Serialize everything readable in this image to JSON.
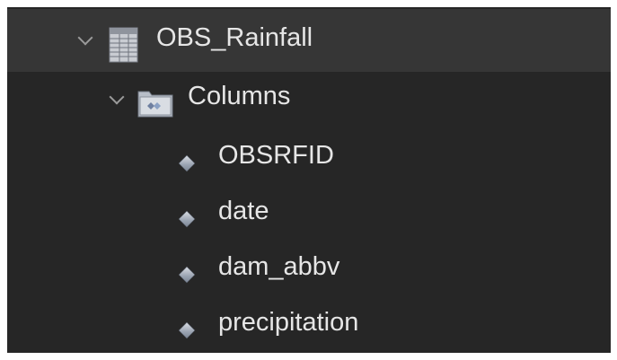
{
  "tree": {
    "table": {
      "name": "OBS_Rainfall",
      "icon": "table-icon",
      "expanded": true
    },
    "folder": {
      "name": "Columns",
      "icon": "columns-folder-icon",
      "expanded": true
    },
    "columns": [
      {
        "name": "OBSRFID",
        "icon": "column-diamond-icon"
      },
      {
        "name": "date",
        "icon": "column-diamond-icon"
      },
      {
        "name": "dam_abbv",
        "icon": "column-diamond-icon"
      },
      {
        "name": "precipitation",
        "icon": "column-diamond-icon"
      }
    ]
  },
  "colors": {
    "panel_background": "#262626",
    "selected_row": "#363636",
    "text": "#e6e6e6",
    "chevron": "#9a9a9a"
  }
}
